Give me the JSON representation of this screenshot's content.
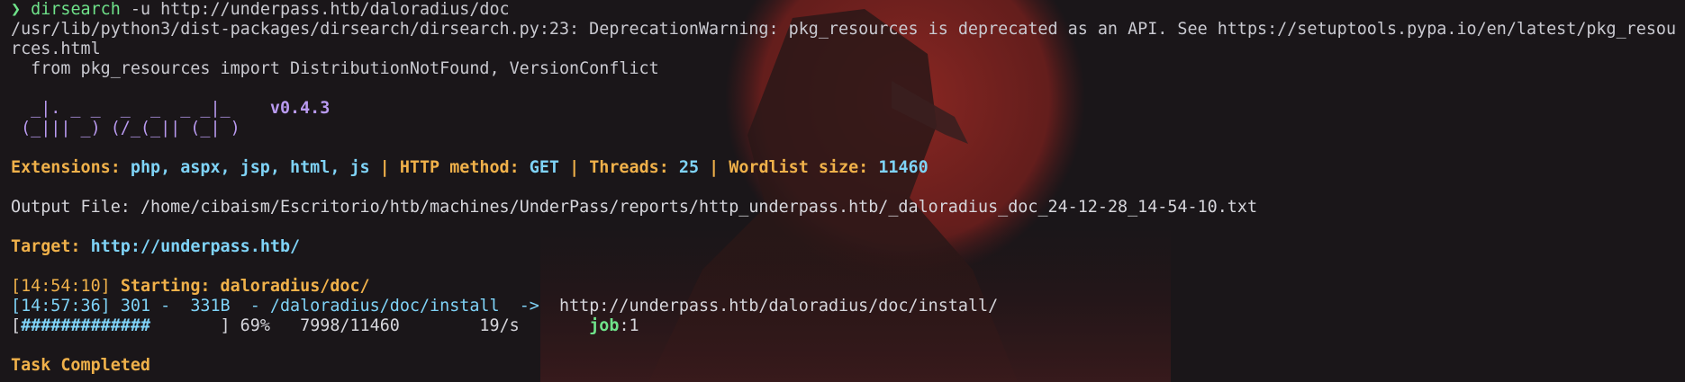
{
  "prompt": {
    "symbol": "❯",
    "command": "dirsearch",
    "args": " -u http://underpass.htb/daloradius/doc"
  },
  "warning": {
    "line1": "/usr/lib/python3/dist-packages/dirsearch/dirsearch.py:23: DeprecationWarning: pkg_resources is deprecated as an API. See https://setuptools.pypa.io/en/latest/pkg_resou",
    "line2": "rces.html",
    "line3": "  from pkg_resources import DistributionNotFound, VersionConflict"
  },
  "banner": {
    "art1": "  _|. _ _  _  _  _ _|_",
    "art2": " (_||| _) (/_(_|| (_| )",
    "version": "v0.4.3"
  },
  "config": {
    "extensions_label": "Extensions:",
    "extensions_value": "php, aspx, jsp, html, js",
    "sep": " | ",
    "method_label": "HTTP method:",
    "method_value": "GET",
    "threads_label": "Threads:",
    "threads_value": "25",
    "wordlist_label": "Wordlist size:",
    "wordlist_value": "11460"
  },
  "output": {
    "label": "Output File:",
    "path": "/home/cibaism/Escritorio/htb/machines/UnderPass/reports/http_underpass.htb/_daloradius_doc_24-12-28_14-54-10.txt"
  },
  "target": {
    "label": "Target:",
    "url": "http://underpass.htb/"
  },
  "log": {
    "start_time": "[14:54:10]",
    "start_label": "Starting:",
    "start_path": "daloradius/doc/",
    "result_time": "[14:57:36]",
    "result_status": "301 -  331B  - /daloradius/doc/install  ->  ",
    "result_redirect": "http://underpass.htb/daloradius/doc/install/"
  },
  "progress": {
    "open_bracket": "[",
    "bar": "#############",
    "pad": "       ",
    "close_and_percent": "] 69%",
    "percent": 69,
    "count": "   7998/11460",
    "rate": "        19/s",
    "job_label": "       job",
    "job_value": ":1"
  },
  "footer": {
    "completed": "Task Completed"
  }
}
